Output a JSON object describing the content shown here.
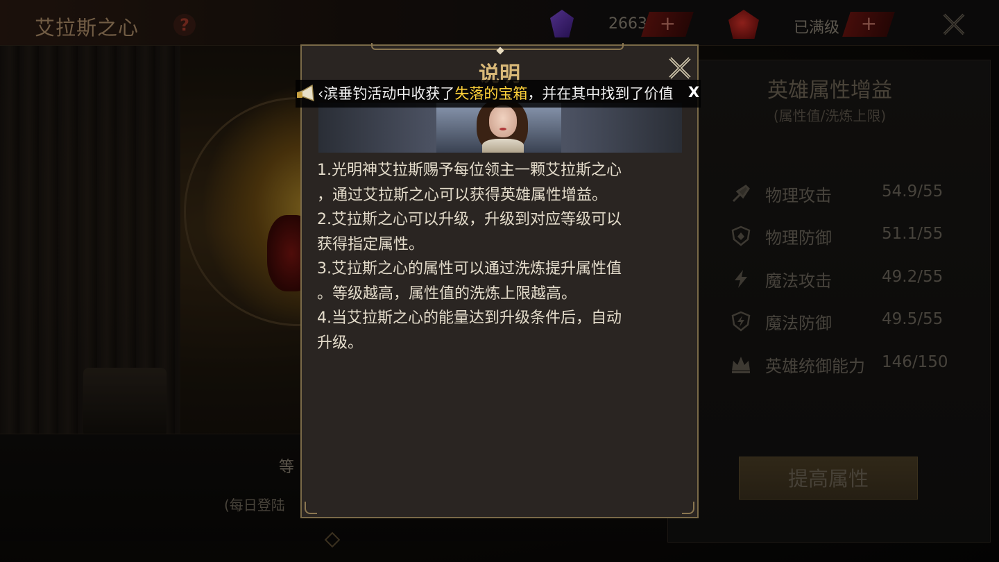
{
  "header": {
    "title": "艾拉斯之心",
    "help_glyph": "?",
    "resource_1": {
      "icon": "purple-gem-icon",
      "count": "2663",
      "plus_glyph": "+"
    },
    "resource_2": {
      "icon": "red-gem-icon",
      "status": "已满级",
      "plus_glyph": "+"
    }
  },
  "background": {
    "level_text": "等",
    "login_text": "(每日登陆"
  },
  "attributes": {
    "title": "英雄属性增益",
    "subtitle": "(属性值/洗炼上限)",
    "rows": [
      {
        "icon": "sword-icon",
        "name": "物理攻击",
        "value": "54.9/55"
      },
      {
        "icon": "shield-icon",
        "name": "物理防御",
        "value": "51.1/55"
      },
      {
        "icon": "lightning-icon",
        "name": "魔法攻击",
        "value": "49.2/55"
      },
      {
        "icon": "magic-shield-icon",
        "name": "魔法防御",
        "value": "49.5/55"
      },
      {
        "icon": "crown-icon",
        "name": "英雄统御能力",
        "value": "146/150"
      }
    ],
    "upgrade_button": "提高属性"
  },
  "modal": {
    "title": "说明",
    "lines": [
      "1.光明神艾拉斯赐予每位领主一颗艾拉斯之心",
      "，通过艾拉斯之心可以获得英雄属性增益。",
      "2.艾拉斯之心可以升级，升级到对应等级可以",
      "获得指定属性。",
      "3.艾拉斯之心的属性可以通过洗炼提升属性值",
      "。等级越高，属性值的洗炼上限越高。",
      "4.当艾拉斯之心的能量达到升级条件后，自动",
      "升级。"
    ]
  },
  "marquee": {
    "text_before": "‹滨垂钓活动中收获了",
    "text_highlight": "失落的宝箱",
    "text_after": "，并在其中找到了价值",
    "close_glyph": "X"
  },
  "colors": {
    "accent_gold": "#d8b878",
    "highlight_yellow": "#ffd23a",
    "plus_red": "#6a1410"
  }
}
